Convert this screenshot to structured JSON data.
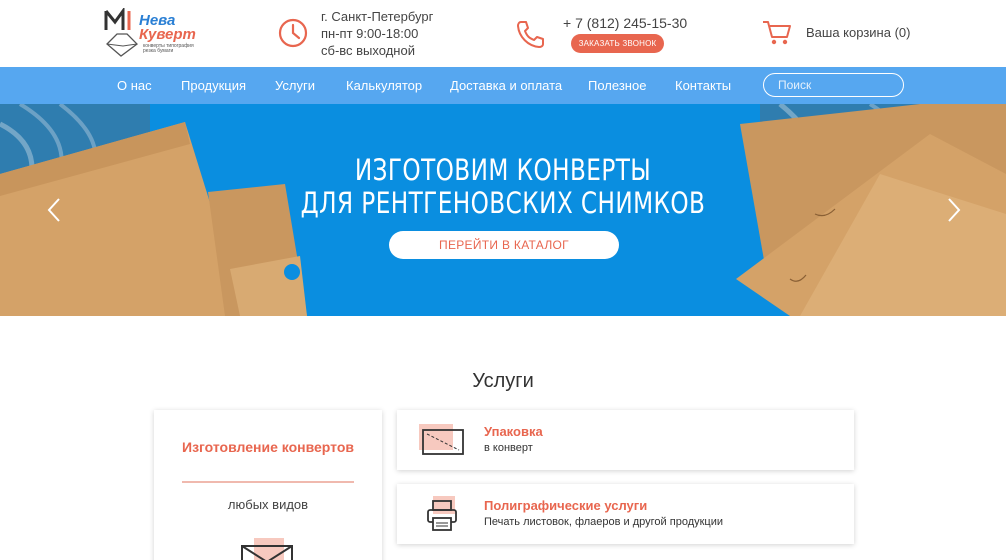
{
  "header": {
    "logo": {
      "line1": "Нева",
      "line2": "Куверт",
      "tagline": "конверты типография резка бумаги"
    },
    "address": {
      "city": "г. Санкт-Петербург",
      "hours_weekdays": "пн-пт 9:00-18:00",
      "hours_weekend": "сб-вс выходной"
    },
    "phone": "+ 7 (812) 245-15-30",
    "call_button": "ЗАКАЗАТЬ ЗВОНОК",
    "cart": "Ваша корзина (0)"
  },
  "nav": {
    "items": [
      "О нас",
      "Продукция",
      "Услуги",
      "Калькулятор",
      "Доставка и оплата",
      "Полезное",
      "Контакты"
    ],
    "search_placeholder": "Поиск"
  },
  "hero": {
    "title_line1": "ИЗГОТОВИМ КОНВЕРТЫ",
    "title_line2": "ДЛЯ РЕНТГЕНОВСКИХ СНИМКОВ",
    "button": "ПЕРЕЙТИ В КАТАЛОГ"
  },
  "services": {
    "title": "Услуги",
    "featured": {
      "title": "Изготовление конвертов",
      "subtitle": "любых видов"
    },
    "items": [
      {
        "title": "Упаковка",
        "subtitle": "в конверт"
      },
      {
        "title": "Полиграфические услуги",
        "subtitle": "Печать листовок, флаеров и другой продукции"
      }
    ]
  },
  "colors": {
    "accent": "#e8664f",
    "nav_bg": "#56a7f0",
    "hero_bg": "#0a8ee0",
    "kraft": "#d4a268"
  }
}
